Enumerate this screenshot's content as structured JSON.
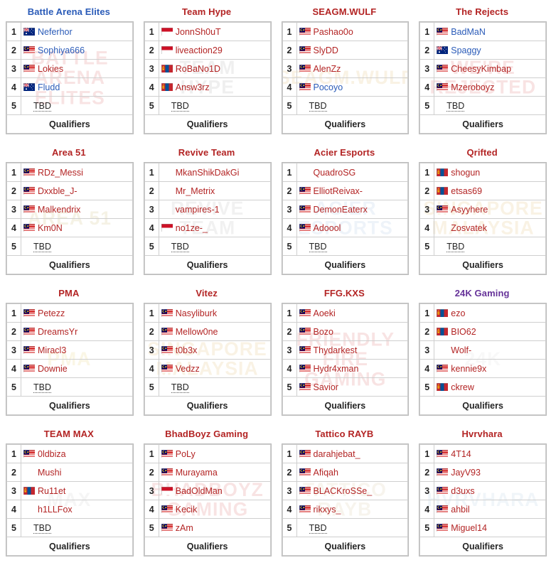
{
  "colors": {
    "link_blue": "#2a5bb8",
    "link_red": "#b32424",
    "link_purple": "#663399",
    "border": "#cfcfcf",
    "card_border": "#bbbbbb"
  },
  "labels": {
    "qualifiers": "Qualifiers",
    "tbd": "TBD"
  },
  "teams": [
    {
      "name": "Battle Arena Elites",
      "name_color": "blue",
      "watermark": "BATTLE\nARENA\nELITES",
      "watermark_color": "#cc3333",
      "footer": "Qualifiers",
      "players": [
        {
          "idx": "1",
          "name": "Neferhor",
          "flag": "au",
          "color": "blue"
        },
        {
          "idx": "2",
          "name": "Sophiya666",
          "flag": "my",
          "color": "blue"
        },
        {
          "idx": "3",
          "name": "Lokies",
          "flag": "my",
          "color": "red"
        },
        {
          "idx": "4",
          "name": "Fludd",
          "flag": "au",
          "color": "blue"
        },
        {
          "idx": "5",
          "name": "TBD",
          "flag": null,
          "color": "tbd"
        }
      ]
    },
    {
      "name": "Team Hype",
      "name_color": "red",
      "watermark": "TEAM\nHYPE",
      "watermark_color": "#888888",
      "footer": "Qualifiers",
      "players": [
        {
          "idx": "1",
          "name": "JonnSh0uT",
          "flag": "id",
          "color": "red"
        },
        {
          "idx": "2",
          "name": "liveaction29",
          "flag": "id",
          "color": "red"
        },
        {
          "idx": "3",
          "name": "RoBaNo1D",
          "flag": "mn",
          "color": "red"
        },
        {
          "idx": "4",
          "name": "Answ3rz",
          "flag": "mn",
          "color": "red"
        },
        {
          "idx": "5",
          "name": "TBD",
          "flag": null,
          "color": "tbd"
        }
      ]
    },
    {
      "name": "SEAGM.WULF",
      "name_color": "red",
      "watermark": "SEAGM.WULF",
      "watermark_color": "#d8a33a",
      "footer": "Qualifiers",
      "players": [
        {
          "idx": "1",
          "name": "Pashao0o",
          "flag": "my",
          "color": "red"
        },
        {
          "idx": "2",
          "name": "SlyDD",
          "flag": "my",
          "color": "red"
        },
        {
          "idx": "3",
          "name": "AlenZz",
          "flag": "my",
          "color": "red"
        },
        {
          "idx": "4",
          "name": "Pocoyo",
          "flag": "my",
          "color": "blue"
        },
        {
          "idx": "5",
          "name": "TBD",
          "flag": null,
          "color": "tbd"
        }
      ]
    },
    {
      "name": "The Rejects",
      "name_color": "red",
      "watermark": "WE'RE\nREJECTED",
      "watermark_color": "#cc3333",
      "footer": "Qualifiers",
      "players": [
        {
          "idx": "1",
          "name": "BadMaN",
          "flag": "my",
          "color": "blue"
        },
        {
          "idx": "2",
          "name": "Spaggy",
          "flag": "au",
          "color": "blue"
        },
        {
          "idx": "3",
          "name": "CheesyKimbap",
          "flag": "my",
          "color": "red"
        },
        {
          "idx": "4",
          "name": "Mzeroboyz",
          "flag": "my",
          "color": "red"
        },
        {
          "idx": "5",
          "name": "TBD",
          "flag": null,
          "color": "tbd"
        }
      ]
    },
    {
      "name": "Area 51",
      "name_color": "red",
      "watermark": "AREA 51",
      "watermark_color": "#b9a23c",
      "footer": "Qualifiers",
      "players": [
        {
          "idx": "1",
          "name": "RDz_Messi",
          "flag": "my",
          "color": "red"
        },
        {
          "idx": "2",
          "name": "Dxxble_J-",
          "flag": "my",
          "color": "red"
        },
        {
          "idx": "3",
          "name": "Malkendrix",
          "flag": "my",
          "color": "red"
        },
        {
          "idx": "4",
          "name": "Km0N",
          "flag": "my",
          "color": "red"
        },
        {
          "idx": "5",
          "name": "TBD",
          "flag": null,
          "color": "tbd"
        }
      ]
    },
    {
      "name": "Revive Team",
      "name_color": "red",
      "watermark": "REVIVE\nTEAM",
      "watermark_color": "#999999",
      "footer": "Qualifiers",
      "players": [
        {
          "idx": "1",
          "name": "MkanShikDakGi",
          "flag": null,
          "color": "red"
        },
        {
          "idx": "2",
          "name": "Mr_Metrix",
          "flag": null,
          "color": "red"
        },
        {
          "idx": "3",
          "name": "vampires-1",
          "flag": null,
          "color": "red"
        },
        {
          "idx": "4",
          "name": "no1ze-_",
          "flag": "id",
          "color": "red"
        },
        {
          "idx": "5",
          "name": "TBD",
          "flag": null,
          "color": "tbd"
        }
      ]
    },
    {
      "name": "Acier Esports",
      "name_color": "red",
      "watermark": "ACIER ESPORTS",
      "watermark_color": "#7fa8d8",
      "footer": "Qualifiers",
      "players": [
        {
          "idx": "1",
          "name": "QuadroSG",
          "flag": null,
          "color": "red"
        },
        {
          "idx": "2",
          "name": "ElliotReivax-",
          "flag": "my",
          "color": "red"
        },
        {
          "idx": "3",
          "name": "DemonEaterx",
          "flag": "my",
          "color": "red"
        },
        {
          "idx": "4",
          "name": "Adoool",
          "flag": "my",
          "color": "red"
        },
        {
          "idx": "5",
          "name": "TBD",
          "flag": null,
          "color": "tbd"
        }
      ]
    },
    {
      "name": "Qrifted",
      "name_color": "red",
      "watermark": "SINGAPORE\nMALAYSIA",
      "watermark_color": "#d8a33a",
      "footer": "Qualifiers",
      "players": [
        {
          "idx": "1",
          "name": "shogun",
          "flag": "mn",
          "color": "red"
        },
        {
          "idx": "2",
          "name": "etsas69",
          "flag": "mn",
          "color": "red"
        },
        {
          "idx": "3",
          "name": "Asyyhere",
          "flag": "my",
          "color": "red"
        },
        {
          "idx": "4",
          "name": "Zosvatek",
          "flag": null,
          "color": "red"
        },
        {
          "idx": "5",
          "name": "TBD",
          "flag": null,
          "color": "tbd"
        }
      ]
    },
    {
      "name": "PMA",
      "name_color": "red",
      "watermark": "PMA",
      "watermark_color": "#e0c23c",
      "footer": "Qualifiers",
      "players": [
        {
          "idx": "1",
          "name": "Petezz",
          "flag": "my",
          "color": "red"
        },
        {
          "idx": "2",
          "name": "DreamsYr",
          "flag": "my",
          "color": "red"
        },
        {
          "idx": "3",
          "name": "Miracl3",
          "flag": "my",
          "color": "red"
        },
        {
          "idx": "4",
          "name": "Downie",
          "flag": "my",
          "color": "red"
        },
        {
          "idx": "5",
          "name": "TBD",
          "flag": null,
          "color": "tbd"
        }
      ]
    },
    {
      "name": "Vitez",
      "name_color": "red",
      "watermark": "SINGAPORE\nMALAYSIA",
      "watermark_color": "#d8a33a",
      "footer": "Qualifiers",
      "players": [
        {
          "idx": "1",
          "name": "Nasyliburk",
          "flag": "my",
          "color": "red"
        },
        {
          "idx": "2",
          "name": "Mellow0ne",
          "flag": "my",
          "color": "red"
        },
        {
          "idx": "3",
          "name": "t0b3x",
          "flag": "my",
          "color": "red"
        },
        {
          "idx": "4",
          "name": "Vedzz",
          "flag": "my",
          "color": "red"
        },
        {
          "idx": "5",
          "name": "TBD",
          "flag": null,
          "color": "tbd"
        }
      ]
    },
    {
      "name": "FFG.KXS",
      "name_color": "red",
      "watermark": "FRIENDLY FIRE\nGAMING",
      "watermark_color": "#cc3333",
      "footer": "Qualifiers",
      "players": [
        {
          "idx": "1",
          "name": "Aoeki",
          "flag": "my",
          "color": "red"
        },
        {
          "idx": "2",
          "name": "Bozo",
          "flag": "my",
          "color": "red"
        },
        {
          "idx": "3",
          "name": "Thydarkest",
          "flag": "my",
          "color": "red"
        },
        {
          "idx": "4",
          "name": "Hydr4xman",
          "flag": "my",
          "color": "red"
        },
        {
          "idx": "5",
          "name": "Savior",
          "flag": "my",
          "color": "red"
        }
      ]
    },
    {
      "name": "24K Gaming",
      "name_color": "purple",
      "watermark": "24K",
      "watermark_color": "#cccccc",
      "footer": "Qualifiers",
      "players": [
        {
          "idx": "1",
          "name": "ezo",
          "flag": "mn",
          "color": "red"
        },
        {
          "idx": "2",
          "name": "BIO62",
          "flag": "mn",
          "color": "red"
        },
        {
          "idx": "3",
          "name": "Wolf-",
          "flag": null,
          "color": "red"
        },
        {
          "idx": "4",
          "name": "kennie9x",
          "flag": "my",
          "color": "red"
        },
        {
          "idx": "5",
          "name": "ckrew",
          "flag": "mn",
          "color": "red"
        }
      ]
    },
    {
      "name": "TEAM MAX",
      "name_color": "red",
      "watermark": "MAX",
      "watermark_color": "#bbbbbb",
      "footer": "Qualifiers",
      "players": [
        {
          "idx": "1",
          "name": "0ldbiza",
          "flag": "my",
          "color": "red"
        },
        {
          "idx": "2",
          "name": "Mushi",
          "flag": null,
          "color": "red"
        },
        {
          "idx": "3",
          "name": "Ru11et",
          "flag": "mn",
          "color": "red"
        },
        {
          "idx": "4",
          "name": "h1LLFox",
          "flag": null,
          "color": "red"
        },
        {
          "idx": "5",
          "name": "TBD",
          "flag": null,
          "color": "tbd"
        }
      ]
    },
    {
      "name": "BhadBoyz Gaming",
      "name_color": "red",
      "watermark": "BHADBOYZ\nGAMING",
      "watermark_color": "#cc3333",
      "footer": "Qualifiers",
      "players": [
        {
          "idx": "1",
          "name": "PoLy",
          "flag": "my",
          "color": "red"
        },
        {
          "idx": "2",
          "name": "Murayama",
          "flag": "my",
          "color": "red"
        },
        {
          "idx": "3",
          "name": "BadOldMan",
          "flag": "id",
          "color": "red"
        },
        {
          "idx": "4",
          "name": "Kecik",
          "flag": "my",
          "color": "red"
        },
        {
          "idx": "5",
          "name": "zAm",
          "flag": "my",
          "color": "red"
        }
      ]
    },
    {
      "name": "Tattico RAYB",
      "name_color": "red",
      "watermark": "TATTICO\nRAYB",
      "watermark_color": "#c9b07a",
      "footer": "Qualifiers",
      "players": [
        {
          "idx": "1",
          "name": "darahjebat_",
          "flag": "my",
          "color": "red"
        },
        {
          "idx": "2",
          "name": "Afiqah",
          "flag": "my",
          "color": "red"
        },
        {
          "idx": "3",
          "name": "BLACKroSSe_",
          "flag": "my",
          "color": "red"
        },
        {
          "idx": "4",
          "name": "rikxys_",
          "flag": "my",
          "color": "red"
        },
        {
          "idx": "5",
          "name": "TBD",
          "flag": null,
          "color": "tbd"
        }
      ]
    },
    {
      "name": "Hvrvhara",
      "name_color": "red",
      "watermark": "HVRVHARA",
      "watermark_color": "#8fb4d8",
      "footer": "Qualifiers",
      "players": [
        {
          "idx": "1",
          "name": "4T14",
          "flag": "my",
          "color": "red"
        },
        {
          "idx": "2",
          "name": "JayV93",
          "flag": "my",
          "color": "red"
        },
        {
          "idx": "3",
          "name": "d3uxs",
          "flag": "my",
          "color": "red"
        },
        {
          "idx": "4",
          "name": "ahbil",
          "flag": "my",
          "color": "red"
        },
        {
          "idx": "5",
          "name": "Miguel14",
          "flag": "my",
          "color": "red"
        }
      ]
    }
  ]
}
